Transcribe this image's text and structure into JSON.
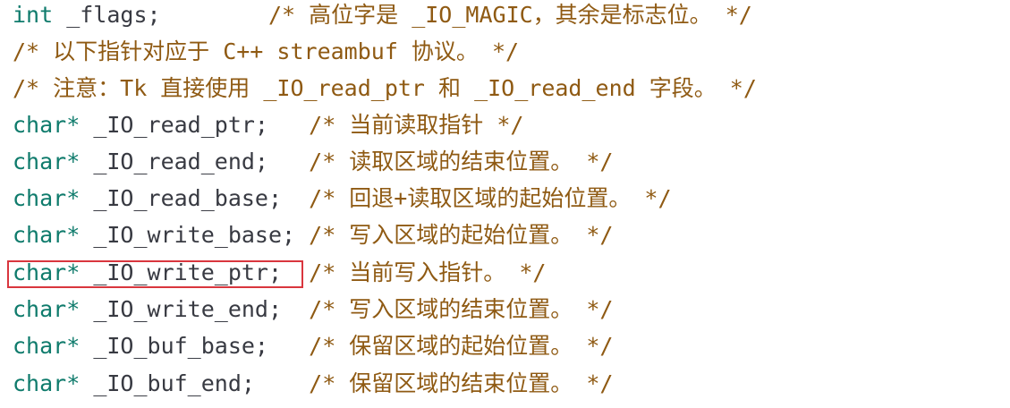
{
  "code": {
    "lines": [
      {
        "type": "int",
        "decl": " _flags;",
        "pad": "        ",
        "comment": "/* 高位字是 _IO_MAGIC，其余是标志位。 */"
      },
      {
        "type": "",
        "decl": "",
        "pad": "",
        "comment": "/* 以下指针对应于 C++ streambuf 协议。 */"
      },
      {
        "type": "",
        "decl": "",
        "pad": "",
        "comment": "/* 注意：Tk 直接使用 _IO_read_ptr 和 _IO_read_end 字段。 */"
      },
      {
        "type": "char*",
        "decl": " _IO_read_ptr;",
        "pad": "   ",
        "comment": "/* 当前读取指针 */"
      },
      {
        "type": "char*",
        "decl": " _IO_read_end;",
        "pad": "   ",
        "comment": "/* 读取区域的结束位置。 */"
      },
      {
        "type": "char*",
        "decl": " _IO_read_base;",
        "pad": "  ",
        "comment": "/* 回退+读取区域的起始位置。 */"
      },
      {
        "type": "char*",
        "decl": " _IO_write_base;",
        "pad": " ",
        "comment": "/* 写入区域的起始位置。 */"
      },
      {
        "type": "char*",
        "decl": " _IO_write_ptr;",
        "pad": "  ",
        "comment": "/* 当前写入指针。 */"
      },
      {
        "type": "char*",
        "decl": " _IO_write_end;",
        "pad": "  ",
        "comment": "/* 写入区域的结束位置。 */"
      },
      {
        "type": "char*",
        "decl": " _IO_buf_base;",
        "pad": "   ",
        "comment": "/* 保留区域的起始位置。 */"
      },
      {
        "type": "char*",
        "decl": " _IO_buf_end;",
        "pad": "    ",
        "comment": "/* 保留区域的结束位置。 */"
      }
    ]
  },
  "highlight": {
    "line_index": 7,
    "color": "#d9363e"
  },
  "colors": {
    "type": "#0f7b6c",
    "identifier": "#383a42",
    "comment": "#8f5a13",
    "background": "#ffffff"
  }
}
